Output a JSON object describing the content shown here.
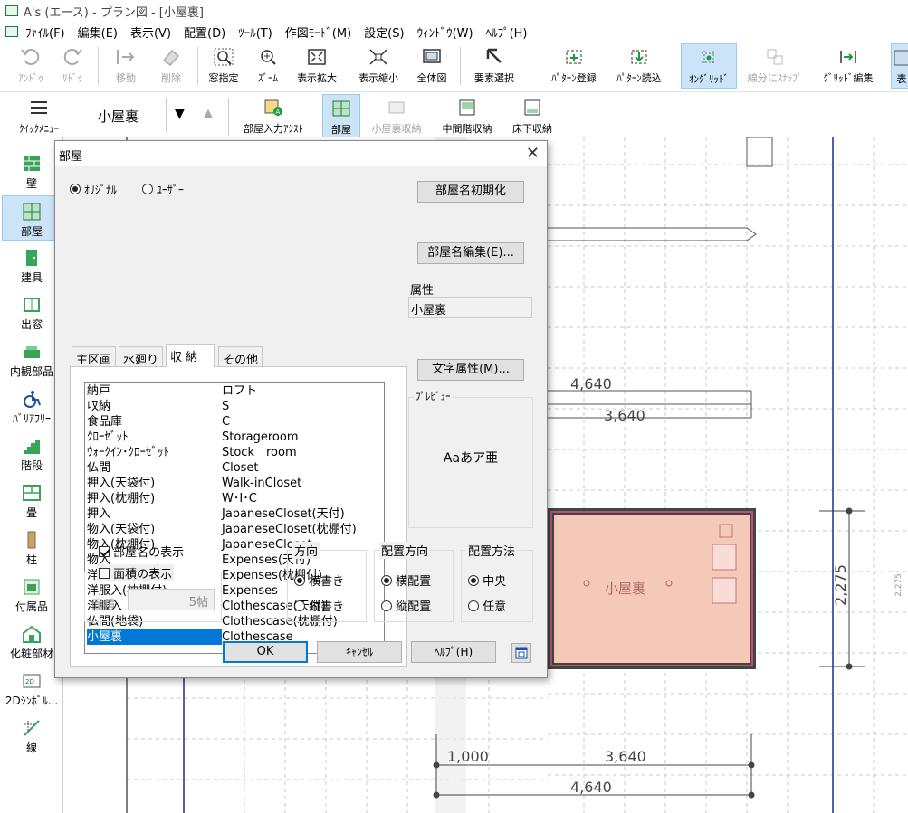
{
  "window": {
    "title": "A's (エース) - プラン図 - [小屋裏]"
  },
  "menu": [
    "ﾌｧｲﾙ(F)",
    "編集(E)",
    "表示(V)",
    "配置(D)",
    "ﾂｰﾙ(T)",
    "作図ﾓｰﾄﾞ(M)",
    "設定(S)",
    "ｳｨﾝﾄﾞｳ(W)",
    "ﾍﾙﾌﾟ(H)"
  ],
  "toolbar1": [
    {
      "label": "ｱﾝﾄﾞｩ",
      "icon": "undo-icon"
    },
    {
      "label": "ﾘﾄﾞｩ",
      "icon": "redo-icon"
    },
    {
      "label": "移動",
      "icon": "move-icon"
    },
    {
      "label": "削除",
      "icon": "eraser-icon"
    },
    {
      "label": "窓指定",
      "icon": "zoom-window-icon"
    },
    {
      "label": "ｽﾞｰﾑ",
      "icon": "zoom-icon"
    },
    {
      "label": "表示拡大",
      "icon": "expand-icon"
    },
    {
      "label": "表示縮小",
      "icon": "shrink-icon"
    },
    {
      "label": "全体図",
      "icon": "fullview-icon"
    },
    {
      "label": "要素選択",
      "icon": "cursor-icon"
    },
    {
      "label": "ﾊﾟﾀｰﾝ登録",
      "icon": "pattern-register-icon"
    },
    {
      "label": "ﾊﾟﾀｰﾝ読込",
      "icon": "pattern-load-icon"
    },
    {
      "label": "ｵﾝｸﾞﾘｯﾄﾞ",
      "icon": "on-grid-icon"
    },
    {
      "label": "線分にｽﾅｯﾌﾟ",
      "icon": "snap-line-icon"
    },
    {
      "label": "ｸﾞﾘｯﾄﾞ編集",
      "icon": "grid-edit-icon"
    },
    {
      "label": "表",
      "icon": "table-icon"
    }
  ],
  "toolbar2": {
    "quick_menu": "ｸｲｯｸﾒﾆｭｰ",
    "mode_value": "小屋裏",
    "dropdown_arrow": "▼",
    "up_arrow": "▲",
    "buttons": [
      "部屋入力ｱｼｽﾄ",
      "部屋",
      "小屋裏収納",
      "中間階収納",
      "床下収納"
    ]
  },
  "left_panel": [
    "壁",
    "部屋",
    "建具",
    "出窓",
    "内観部品",
    "ﾊﾞﾘｱﾌﾘｰ",
    "階段",
    "畳",
    "柱",
    "付属品",
    "化粧部材",
    "2Dｼﾝﾎﾞﾙ...",
    "線"
  ],
  "canvas": {
    "dimensions": [
      "4,640",
      "3,640",
      "2,275",
      "1,000",
      "3,640",
      "4,640",
      "2,275"
    ],
    "room_label": "小屋裏"
  },
  "dialog": {
    "title": "部屋",
    "close": "✕",
    "radio_original": "ｵﾘｼﾞﾅﾙ",
    "radio_user": "ﾕｰｻﾞｰ",
    "tabs": [
      "主区画",
      "水廻り",
      "収 納",
      "その他"
    ],
    "list": [
      [
        "納戸",
        "ロフト"
      ],
      [
        "収納",
        "S"
      ],
      [
        "食品庫",
        "C"
      ],
      [
        "ｸﾛｰｾﾞｯﾄ",
        "Storageroom"
      ],
      [
        "ｳｫｰｸｲﾝ･ｸﾛｰｾﾞｯﾄ",
        "Stock　room"
      ],
      [
        "仏間",
        "Closet"
      ],
      [
        "押入(天袋付)",
        "Walk-inCloset"
      ],
      [
        "押入(枕棚付)",
        "W･I･C"
      ],
      [
        "押入",
        "JapaneseCloset(天付)"
      ],
      [
        "物入(天袋付)",
        "JapaneseCloset(枕棚付)"
      ],
      [
        "物入(枕棚付)",
        "JapaneseCloset"
      ],
      [
        "物入",
        "Expenses(天付)"
      ],
      [
        "洋服入(天袋付)",
        "Expenses(枕棚付)"
      ],
      [
        "洋服入(枕棚付)",
        "Expenses"
      ],
      [
        "洋服入",
        "Clothescase(天付)"
      ],
      [
        "仏間(地袋)",
        "Clothescase(枕棚付)"
      ],
      [
        "小屋裏",
        "Clothescase"
      ]
    ],
    "btn_reset": "部屋名初期化",
    "btn_edit": "部屋名編集(E)...",
    "attr_label": "属性",
    "attr_value": "小屋裏",
    "btn_text_attr": "文字属性(M)...",
    "preview_label": "ﾌﾟﾚﾋﾞｭｰ",
    "preview_text": "Aaあア亜",
    "show_name": "部屋名の表示",
    "show_area": "面積の表示",
    "area_label": "面積",
    "area_value": "5帖",
    "direction_title": "方向",
    "dir_h": "横書き",
    "dir_v": "縦書き",
    "place_dir_title": "配置方向",
    "pd_h": "横配置",
    "pd_v": "縦配置",
    "place_method_title": "配置方法",
    "pm_center": "中央",
    "pm_free": "任意",
    "ok": "OK",
    "cancel": "ｷｬﾝｾﾙ",
    "help": "ﾍﾙﾌﾟ(H)"
  }
}
